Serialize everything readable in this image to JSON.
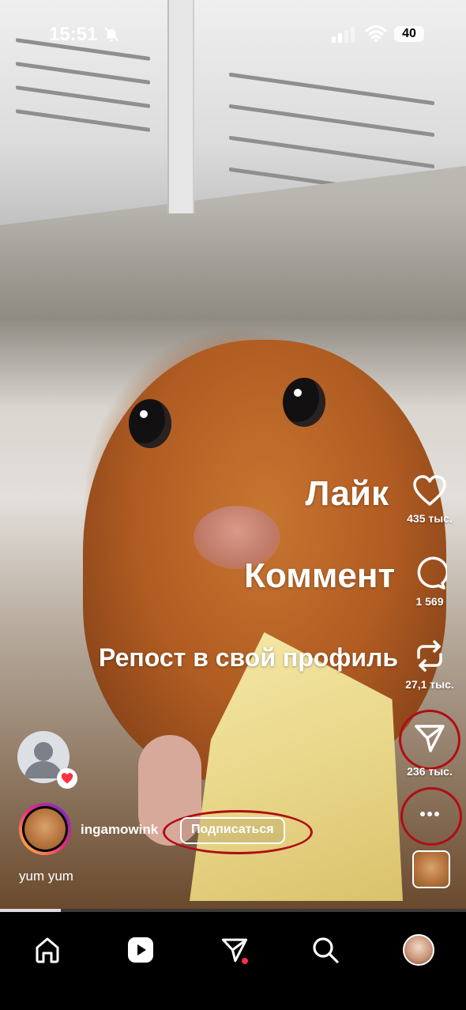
{
  "status_bar": {
    "time": "15:51",
    "battery": "40"
  },
  "overlays": {
    "like_hint": "Лайк",
    "comment_hint": "Коммент",
    "repost_hint": "Репост в свой профиль"
  },
  "actions": {
    "likes": "435 тыс.",
    "comments": "1 569",
    "reposts": "27,1 тыс.",
    "shares": "236 тыс."
  },
  "post": {
    "username": "ingamowink",
    "follow_label": "Подписаться",
    "caption": "yum yum"
  },
  "progress_fraction": 0.13,
  "colors": {
    "accent_ring": "#b00d14",
    "notification_dot": "#ff2d4a"
  },
  "icons": [
    "heart-icon",
    "comment-icon",
    "repost-icon",
    "share-icon",
    "more-icon",
    "home-icon",
    "reels-icon",
    "messages-icon",
    "search-icon"
  ]
}
